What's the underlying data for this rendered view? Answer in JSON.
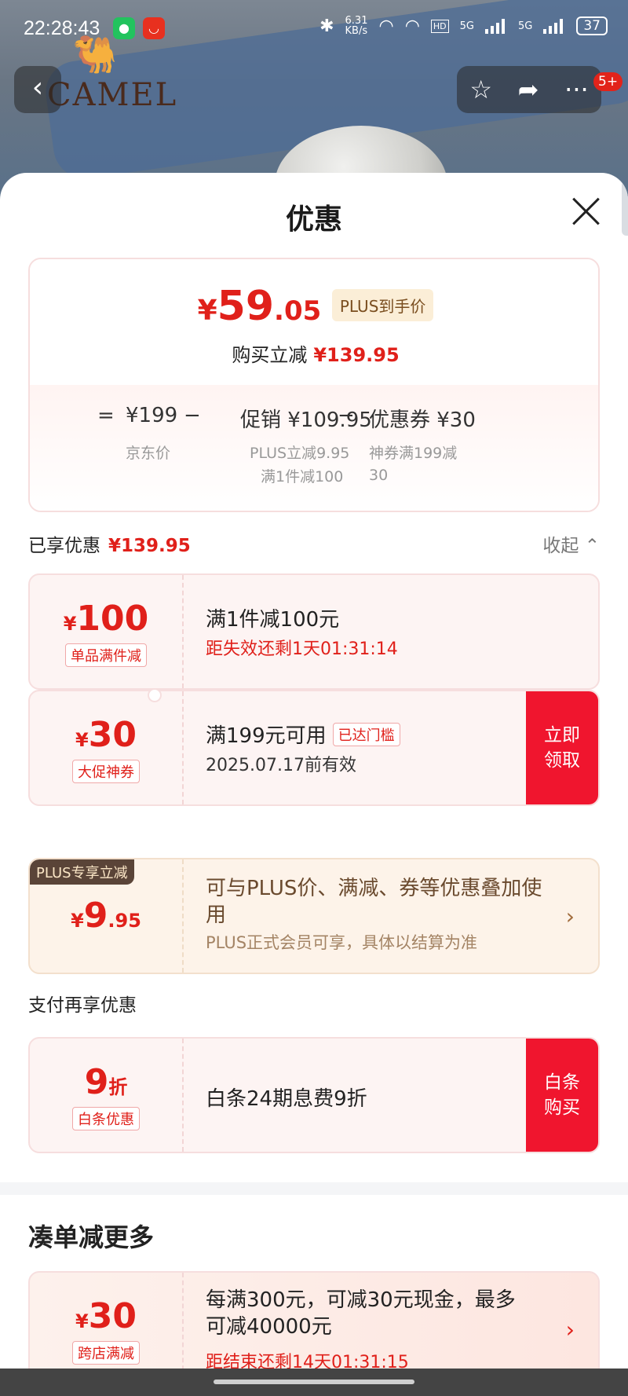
{
  "status_bar": {
    "time": "22:28:43",
    "net_speed": "6.31\nKB/s",
    "battery": "37",
    "signal1": "5G",
    "signal2": "5G"
  },
  "background": {
    "brand": "CAMEL",
    "notification_badge": "5+"
  },
  "sheet": {
    "title": "优惠",
    "price": {
      "yen": "¥",
      "integer": "59",
      "decimal": ".05",
      "tag": "PLUS到手价",
      "save_label": "购买立减",
      "save_amount": "¥139.95"
    },
    "formula": {
      "eq": "=",
      "base_price": "¥199",
      "base_label": "京东价",
      "minus1": "−",
      "promo": "促销 ¥109.95",
      "promo_line1": "PLUS立减9.95",
      "promo_line2": "满1件减100",
      "minus2": "−",
      "coupon": "优惠券 ¥30",
      "coupon_line1": "神券满199减",
      "coupon_line2": "30"
    },
    "enjoyed": {
      "label": "已享优惠",
      "amount": "¥139.95",
      "collapse": "收起"
    },
    "coupons": [
      {
        "yen": "¥",
        "value": "100",
        "tag": "单品满件减",
        "title": "满1件减100元",
        "subtitle": "距失效还剩1天01:31:14"
      },
      {
        "yen": "¥",
        "value": "30",
        "tag": "大促神券",
        "title": "满199元可用",
        "badge": "已达门槛",
        "subtitle": "2025.07.17前有效",
        "button": "立即\n领取"
      }
    ],
    "plus": {
      "label": "PLUS专享立减",
      "yen": "¥",
      "integer": "9",
      "decimal": ".95",
      "title": "可与PLUS价、满减、券等优惠叠加使用",
      "subtitle": "PLUS正式会员可享，具体以结算为准"
    },
    "pay_section": {
      "title": "支付再享优惠",
      "value": "9",
      "unit": "折",
      "tag": "白条优惠",
      "text": "白条24期息费9折",
      "button": "白条\n购买"
    },
    "more": {
      "title": "凑单减更多",
      "yen": "¥",
      "value": "30",
      "tag": "跨店满减",
      "text": "每满300元，可减30元现金，最多可减40000元",
      "subtitle": "距结束还剩14天01:31:15"
    }
  },
  "colors": {
    "accent_red": "#e0201a",
    "button_red": "#f0152e",
    "plus_brown": "#5a4438"
  }
}
